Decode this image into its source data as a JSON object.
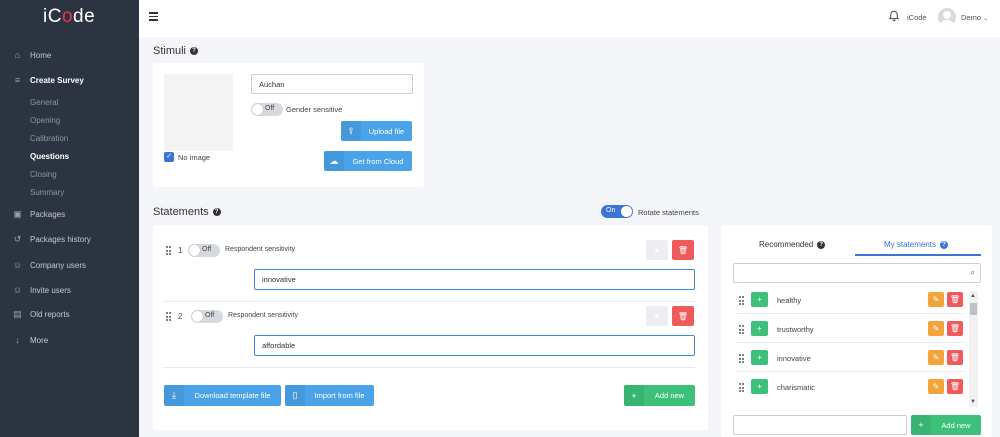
{
  "app": {
    "logo_prefix": "iC",
    "logo_o": "o",
    "logo_suffix": "de"
  },
  "sidebar": {
    "home": "Home",
    "create_survey": "Create Survey",
    "sub": [
      "General",
      "Opening",
      "Calibration",
      "Questions",
      "Closing",
      "Summary"
    ],
    "packages": "Packages",
    "packages_history": "Packages history",
    "company_users": "Company users",
    "invite_users": "Invite users",
    "old_reports": "Old reports",
    "more": "More"
  },
  "topbar": {
    "company": "iCode",
    "user": "Demo",
    "user_caret": "⌄"
  },
  "stimuli": {
    "title": "Stimuli",
    "name_value": "Auchan",
    "gender_toggle": "Off",
    "gender_label": "Gender sensitive",
    "upload_label": "Upload file",
    "cloud_label": "Get from Cloud",
    "no_image_label": "No image",
    "no_image_checked": true
  },
  "statements": {
    "title": "Statements",
    "rotate_toggle": "On",
    "rotate_label": "Rotate statements",
    "items": [
      {
        "num": "1",
        "toggle": "Off",
        "sensitivity_label": "Respondent sensitivity",
        "value": "innovative"
      },
      {
        "num": "2",
        "toggle": "Off",
        "sensitivity_label": "Respondent sensitivity",
        "value": "affordable"
      }
    ],
    "download_label": "Download template file",
    "import_label": "Import from file",
    "add_new_label": "Add new"
  },
  "library": {
    "tab_recommended": "Recommended",
    "tab_my": "My statements",
    "search_placeholder": "",
    "items": [
      "healthy",
      "trustworthy",
      "innovative",
      "charismatic"
    ],
    "new_placeholder": "",
    "add_new_label": "Add new"
  },
  "colors": {
    "sidebar": "#2d3441",
    "accent_blue": "#4aa3e8",
    "green": "#3cc07a",
    "red": "#ef5a5a",
    "orange": "#f3a43a",
    "logo_red": "#e8344e"
  }
}
